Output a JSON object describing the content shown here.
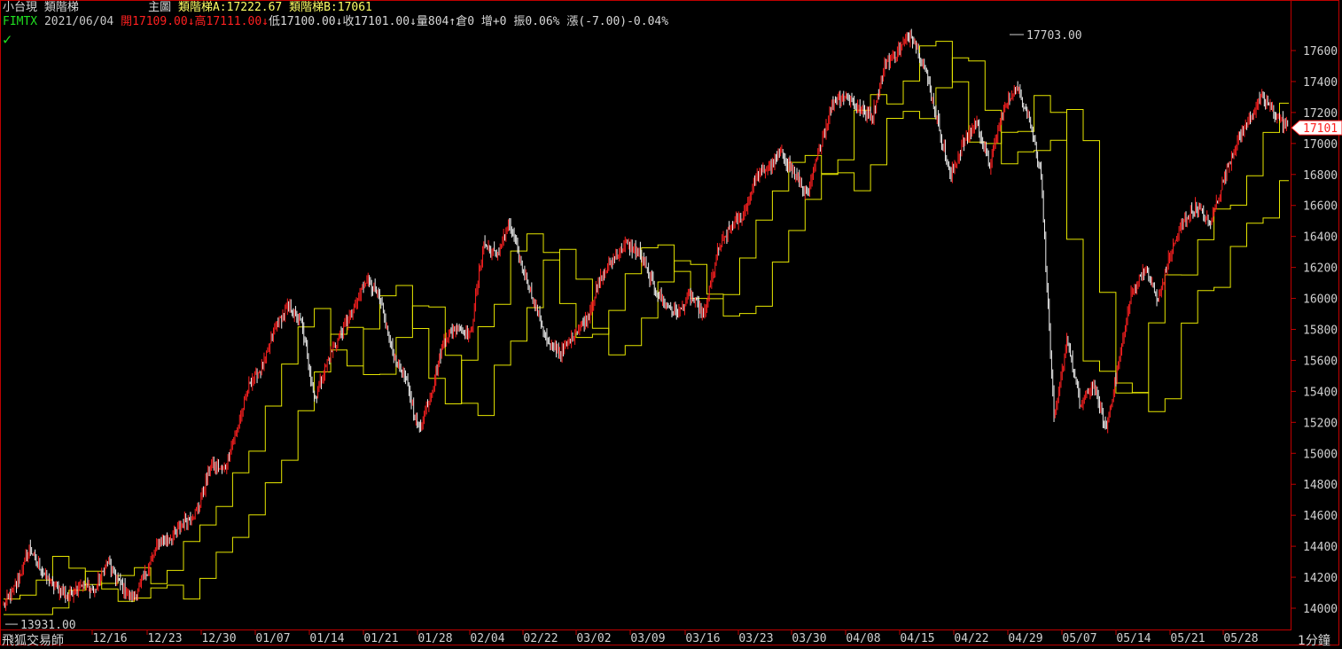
{
  "header": {
    "symbol_name": "小台現",
    "indicator_name": "類階梯",
    "chart_label": "主圖",
    "ladder_a": "類階梯A:17222.67",
    "ladder_b": "類階梯B:17061"
  },
  "quote": {
    "code": "FIMTX",
    "date": "2021/06/04",
    "open": "開17109.00",
    "open_arrow": "↓",
    "high": "高17111.00",
    "high_arrow": "↓",
    "low": "低17100.00",
    "low_arrow": "↓",
    "close": "收17101.00",
    "close_arrow": "↓",
    "volume": "量804",
    "volume_arrow": "↑",
    "open_interest": "倉0",
    "oi_change": "增+0",
    "amplitude": "振0.06%",
    "change": "漲(-7.00)-0.04%"
  },
  "footer": {
    "brand": "飛狐交易師",
    "period": "1分鐘"
  },
  "colors": {
    "background": "#000000",
    "frame": "#c00000",
    "candle_up": "#ff2020",
    "candle_down": "#f0f0f0",
    "ladder": "#e6e600",
    "price_tag": "#ff2020"
  },
  "chart_data": {
    "type": "candlestick",
    "y_ticks": [
      14000,
      14200,
      14400,
      14600,
      14800,
      15000,
      15200,
      15400,
      15600,
      15800,
      16000,
      16200,
      16400,
      16600,
      16800,
      17000,
      17200,
      17400,
      17600
    ],
    "ylim": [
      13900,
      17800
    ],
    "x_labels": [
      "12/16",
      "12/23",
      "12/30",
      "01/07",
      "01/14",
      "01/21",
      "01/28",
      "02/04",
      "02/22",
      "03/02",
      "03/09",
      "03/16",
      "03/23",
      "03/30",
      "04/08",
      "04/15",
      "04/22",
      "04/29",
      "05/07",
      "05/14",
      "05/21",
      "05/28"
    ],
    "annotations": {
      "max_label": "17703.00",
      "max_value": 17703,
      "min_label": "13931.00",
      "min_value": 13931,
      "last_price_label": "17101",
      "last_price": 17101
    },
    "price_path": [
      14010,
      14150,
      14390,
      14230,
      14130,
      14080,
      14160,
      14110,
      14300,
      14150,
      14060,
      14230,
      14420,
      14460,
      14560,
      14640,
      14930,
      14890,
      15150,
      15460,
      15560,
      15820,
      15950,
      15830,
      15350,
      15600,
      15780,
      15920,
      16140,
      15990,
      15650,
      15480,
      15150,
      15400,
      15750,
      15820,
      15760,
      16360,
      16280,
      16480,
      16200,
      15950,
      15700,
      15650,
      15780,
      15880,
      16120,
      16260,
      16350,
      16300,
      16100,
      15960,
      15900,
      16020,
      15880,
      16280,
      16460,
      16530,
      16790,
      16850,
      16930,
      16800,
      16650,
      17000,
      17280,
      17310,
      17220,
      17180,
      17520,
      17600,
      17703,
      17500,
      17150,
      16780,
      17000,
      17150,
      16850,
      17200,
      17360,
      17200,
      16800,
      15200,
      15750,
      15300,
      15450,
      15150,
      15600,
      16050,
      16200,
      15980,
      16300,
      16500,
      16600,
      16480,
      16750,
      17000,
      17150,
      17300,
      17200,
      17101
    ]
  }
}
